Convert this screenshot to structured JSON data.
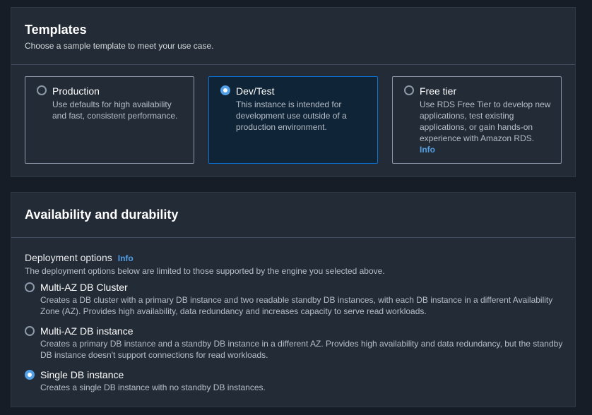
{
  "templates": {
    "title": "Templates",
    "subtitle": "Choose a sample template to meet your use case.",
    "cards": [
      {
        "title": "Production",
        "description": "Use defaults for high availability and fast, consistent performance.",
        "selected": false
      },
      {
        "title": "Dev/Test",
        "description": "This instance is intended for development use outside of a production environment.",
        "selected": true
      },
      {
        "title": "Free tier",
        "description": "Use RDS Free Tier to develop new applications, test existing applications, or gain hands-on experience with Amazon RDS.",
        "info": "Info",
        "selected": false
      }
    ]
  },
  "availability": {
    "title": "Availability and durability",
    "deployment_label": "Deployment options",
    "info": "Info",
    "deployment_desc": "The deployment options below are limited to those supported by the engine you selected above.",
    "options": [
      {
        "title": "Multi-AZ DB Cluster",
        "description": "Creates a DB cluster with a primary DB instance and two readable standby DB instances, with each DB instance in a different Availability Zone (AZ). Provides high availability, data redundancy and increases capacity to serve read workloads.",
        "selected": false
      },
      {
        "title": "Multi-AZ DB instance",
        "description": "Creates a primary DB instance and a standby DB instance in a different AZ. Provides high availability and data redundancy, but the standby DB instance doesn't support connections for read workloads.",
        "selected": false
      },
      {
        "title": "Single DB instance",
        "description": "Creates a single DB instance with no standby DB instances.",
        "selected": true
      }
    ]
  },
  "colors": {
    "accent": "#539fe5",
    "selected_border": "#0972d3",
    "panel": "#232b37",
    "background": "#161d26"
  }
}
